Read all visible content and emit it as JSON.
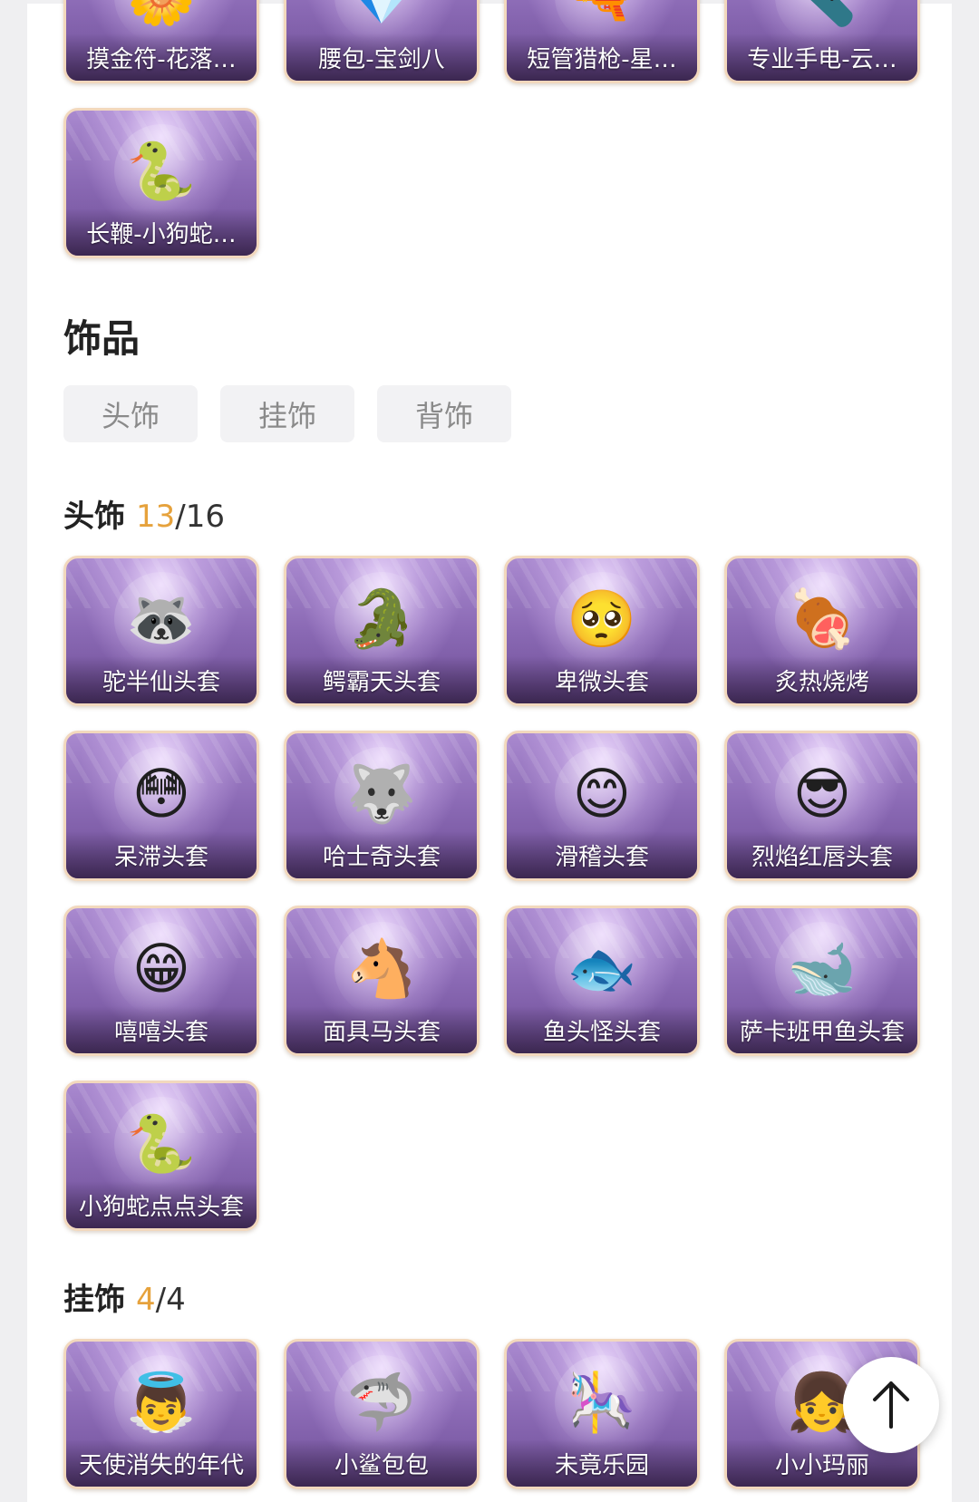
{
  "weapons": {
    "items": [
      {
        "label": "摸金符-花落…",
        "icon": "amulet-flower-icon",
        "glyph": "🌼"
      },
      {
        "label": "腰包-宝剑八",
        "icon": "belt-bag-icon",
        "glyph": "💎"
      },
      {
        "label": "短管猎枪-星…",
        "icon": "shotgun-icon",
        "glyph": "🔫"
      },
      {
        "label": "专业手电-云…",
        "icon": "flashlight-icon",
        "glyph": "🔦"
      },
      {
        "label": "长鞭-小狗蛇…",
        "icon": "whip-snake-icon",
        "glyph": "🐍"
      }
    ]
  },
  "accessories": {
    "title": "饰品",
    "tabs": [
      "头饰",
      "挂饰",
      "背饰"
    ]
  },
  "headwear": {
    "title": "头饰",
    "owned": "13",
    "total": "/16",
    "items": [
      {
        "label": "驼半仙头套",
        "icon": "raccoon-mask-icon",
        "glyph": "🦝"
      },
      {
        "label": "鳄霸天头套",
        "icon": "crocodile-mask-icon",
        "glyph": "🐊"
      },
      {
        "label": "卑微头套",
        "icon": "humble-emoji-mask-icon",
        "glyph": "🥺"
      },
      {
        "label": "炙热烧烤",
        "icon": "barbecue-mask-icon",
        "glyph": "🍖"
      },
      {
        "label": "呆滞头套",
        "icon": "dazed-emoji-mask-icon",
        "glyph": "😳"
      },
      {
        "label": "哈士奇头套",
        "icon": "husky-mask-icon",
        "glyph": "🐺"
      },
      {
        "label": "滑稽头套",
        "icon": "funny-emoji-mask-icon",
        "glyph": "😊"
      },
      {
        "label": "烈焰红唇头套",
        "icon": "pikachu-sunglasses-mask-icon",
        "glyph": "😎"
      },
      {
        "label": "嘻嘻头套",
        "icon": "grin-emoji-mask-icon",
        "glyph": "😁"
      },
      {
        "label": "面具马头套",
        "icon": "horse-mask-icon",
        "glyph": "🐴"
      },
      {
        "label": "鱼头怪头套",
        "icon": "fish-head-mask-icon",
        "glyph": "🐟"
      },
      {
        "label": "萨卡班甲鱼头套",
        "icon": "sacabambaspis-mask-icon",
        "glyph": "🐋"
      },
      {
        "label": "小狗蛇点点头套",
        "icon": "snake-mask-icon",
        "glyph": "🐍"
      }
    ]
  },
  "pendants": {
    "title": "挂饰",
    "owned": "4",
    "total": "/4",
    "items": [
      {
        "label": "天使消失的年代",
        "icon": "angel-doll-icon",
        "glyph": "👼"
      },
      {
        "label": "小鲨包包",
        "icon": "shark-bag-icon",
        "glyph": "🦈"
      },
      {
        "label": "未竟乐园",
        "icon": "paradise-doll-icon",
        "glyph": "🎠"
      },
      {
        "label": "小小玛丽",
        "icon": "mary-doll-icon",
        "glyph": "👧"
      }
    ]
  },
  "scroll_top": {
    "icon": "arrow-up-icon"
  }
}
